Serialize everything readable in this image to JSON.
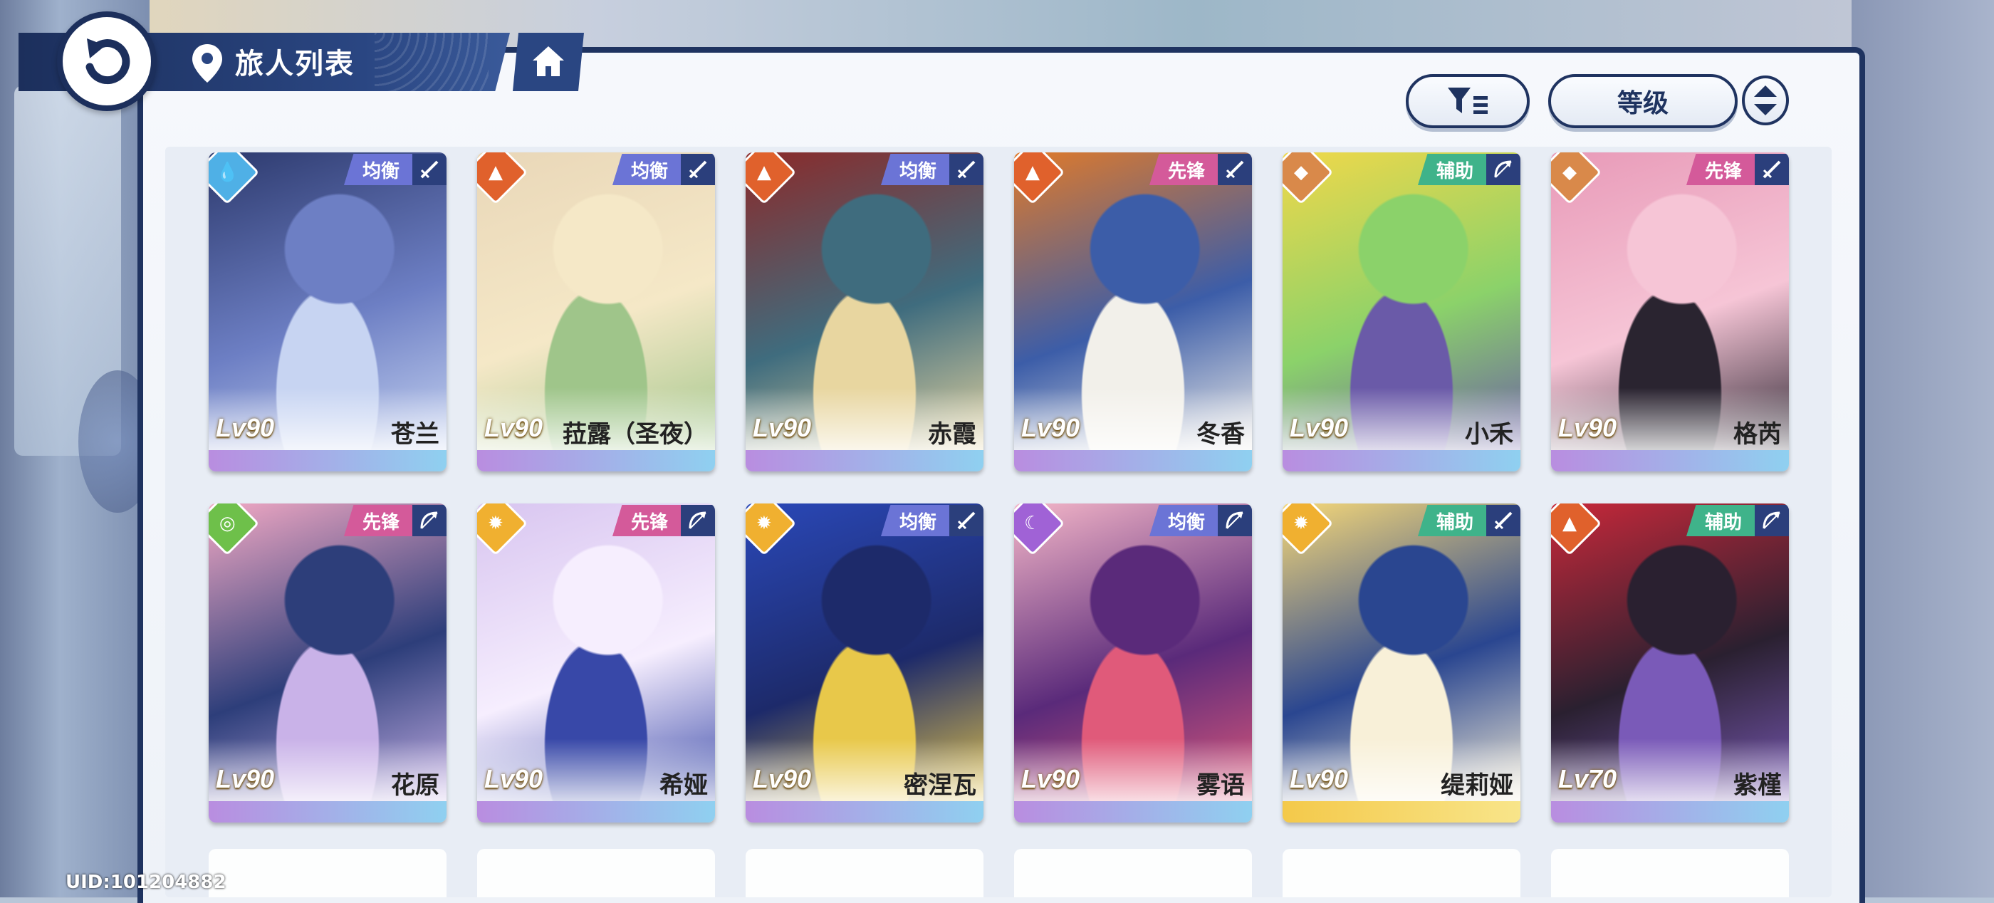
{
  "header": {
    "title": "旅人列表"
  },
  "controls": {
    "sort_label": "等级"
  },
  "footer": {
    "uid": "UID:101204882"
  },
  "colors": {
    "navy": "#1f3360",
    "role_balance": "#6b74d6",
    "role_vanguard": "#d45a9a",
    "role_support": "#3fb38a",
    "elem_water": "#4fb0e6",
    "elem_fire": "#e0612c",
    "elem_earth": "#d9894a",
    "elem_wind": "#6ec04a",
    "elem_light": "#f0b030",
    "elem_dark": "#a062d6"
  },
  "cards": [
    {
      "name": "苍兰",
      "level": "Lv90",
      "role": "均衡",
      "element": "water-icon",
      "weapon": "sword-icon"
    },
    {
      "name": "菈露（圣夜）",
      "level": "Lv90",
      "role": "均衡",
      "element": "fire-icon",
      "weapon": "sword-icon"
    },
    {
      "name": "赤霞",
      "level": "Lv90",
      "role": "均衡",
      "element": "fire-icon",
      "weapon": "sword-icon"
    },
    {
      "name": "冬香",
      "level": "Lv90",
      "role": "先锋",
      "element": "fire-icon",
      "weapon": "sword-icon"
    },
    {
      "name": "小禾",
      "level": "Lv90",
      "role": "辅助",
      "element": "earth-icon",
      "weapon": "bow-icon"
    },
    {
      "name": "格芮",
      "level": "Lv90",
      "role": "先锋",
      "element": "earth-icon",
      "weapon": "sword-icon"
    },
    {
      "name": "花原",
      "level": "Lv90",
      "role": "先锋",
      "element": "wind-icon",
      "weapon": "bow-icon"
    },
    {
      "name": "希娅",
      "level": "Lv90",
      "role": "先锋",
      "element": "light-icon",
      "weapon": "bow-icon"
    },
    {
      "name": "密涅瓦",
      "level": "Lv90",
      "role": "均衡",
      "element": "light-icon",
      "weapon": "sword-icon"
    },
    {
      "name": "雾语",
      "level": "Lv90",
      "role": "均衡",
      "element": "dark-icon",
      "weapon": "bow-icon"
    },
    {
      "name": "缇莉娅",
      "level": "Lv90",
      "role": "辅助",
      "element": "light-icon",
      "weapon": "sword-icon"
    },
    {
      "name": "紫槿",
      "level": "Lv70",
      "role": "辅助",
      "element": "fire-icon",
      "weapon": "bow-icon"
    }
  ]
}
